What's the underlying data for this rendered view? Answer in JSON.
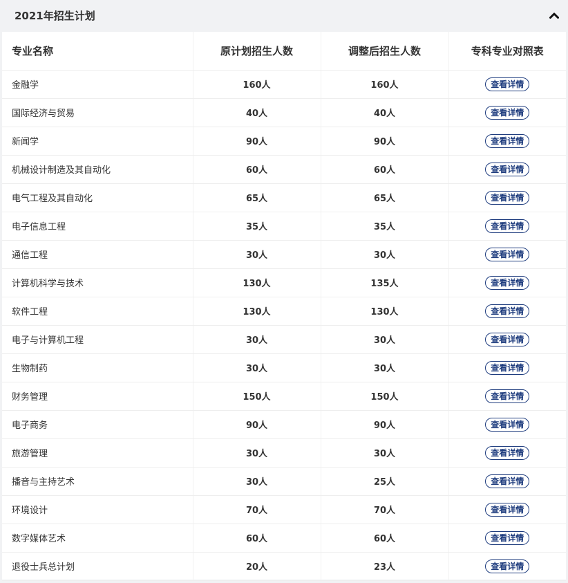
{
  "panel": {
    "title": "2021年招生计划"
  },
  "table": {
    "headers": [
      "专业名称",
      "原计划招生人数",
      "调整后招生人数",
      "专科专业对照表"
    ],
    "button_label": "查看详情",
    "rows": [
      {
        "name": "金融学",
        "original": "160人",
        "adjusted": "160人"
      },
      {
        "name": "国际经济与贸易",
        "original": "40人",
        "adjusted": "40人"
      },
      {
        "name": "新闻学",
        "original": "90人",
        "adjusted": "90人"
      },
      {
        "name": "机械设计制造及其自动化",
        "original": "60人",
        "adjusted": "60人"
      },
      {
        "name": "电气工程及其自动化",
        "original": "65人",
        "adjusted": "65人"
      },
      {
        "name": "电子信息工程",
        "original": "35人",
        "adjusted": "35人"
      },
      {
        "name": "通信工程",
        "original": "30人",
        "adjusted": "30人"
      },
      {
        "name": "计算机科学与技术",
        "original": "130人",
        "adjusted": "135人"
      },
      {
        "name": "软件工程",
        "original": "130人",
        "adjusted": "130人"
      },
      {
        "name": "电子与计算机工程",
        "original": "30人",
        "adjusted": "30人"
      },
      {
        "name": "生物制药",
        "original": "30人",
        "adjusted": "30人"
      },
      {
        "name": "财务管理",
        "original": "150人",
        "adjusted": "150人"
      },
      {
        "name": "电子商务",
        "original": "90人",
        "adjusted": "90人"
      },
      {
        "name": "旅游管理",
        "original": "30人",
        "adjusted": "30人"
      },
      {
        "name": "播音与主持艺术",
        "original": "30人",
        "adjusted": "25人"
      },
      {
        "name": "环境设计",
        "original": "70人",
        "adjusted": "70人"
      },
      {
        "name": "数字媒体艺术",
        "original": "60人",
        "adjusted": "60人"
      },
      {
        "name": "退役士兵总计划",
        "original": "20人",
        "adjusted": "23人"
      }
    ]
  },
  "icons": {
    "collapse": "chevron-up-icon"
  },
  "colors": {
    "accent": "#1e3c7e",
    "header_bg": "#f1f2f4"
  }
}
